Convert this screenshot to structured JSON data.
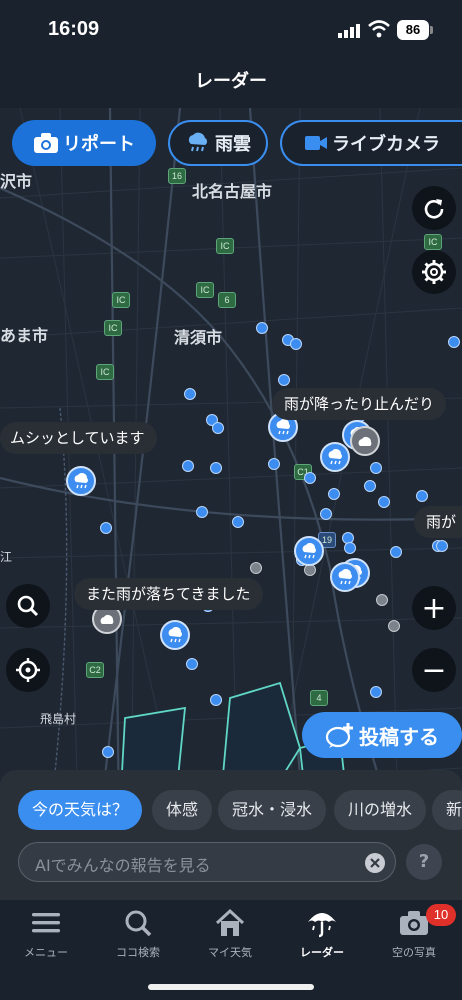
{
  "status": {
    "time": "16:09",
    "battery": "86"
  },
  "header": {
    "title": "レーダー"
  },
  "chips": {
    "report": "リポート",
    "rain": "雨雲",
    "camera": "ライブカメラ"
  },
  "places": {
    "kitanagoya": "北名古屋市",
    "kiyosu": "清須市",
    "ama": "あま市",
    "sawa": "沢市",
    "tobishima": "飛島村",
    "edge_left": "江"
  },
  "road_badges": [
    "16",
    "IC",
    "IC",
    "IC",
    "6",
    "IC",
    "IC",
    "IC",
    "C1",
    "19",
    "C2",
    "4"
  ],
  "bubbles": {
    "b1": "雨が降ったり止んだり",
    "b2": "ムシッとしています",
    "b3": "また雨が落ちてきました",
    "b4": "雨が"
  },
  "map_controls": {
    "refresh": "refresh-icon",
    "settings": "gear-icon",
    "search": "search-icon",
    "locate": "locate-icon",
    "zoom_in": "+",
    "zoom_out": "−"
  },
  "post_button": "投稿する",
  "quick_chips": [
    "今の天気は？",
    "体感",
    "冠水・浸水",
    "川の増水",
    "新"
  ],
  "ai_search": {
    "placeholder": "AIでみんなの報告を見る"
  },
  "help": "?",
  "tabs": [
    {
      "label": "メニュー",
      "icon": "menu-icon"
    },
    {
      "label": "ココ検索",
      "icon": "search-icon"
    },
    {
      "label": "マイ天気",
      "icon": "home-icon"
    },
    {
      "label": "レーダー",
      "icon": "umbrella-icon"
    },
    {
      "label": "空の写真",
      "icon": "camera-icon"
    }
  ],
  "photo_badge": "10",
  "colors": {
    "accent": "#3a8ef0",
    "background": "#121a24",
    "sheet": "#2a3038"
  }
}
